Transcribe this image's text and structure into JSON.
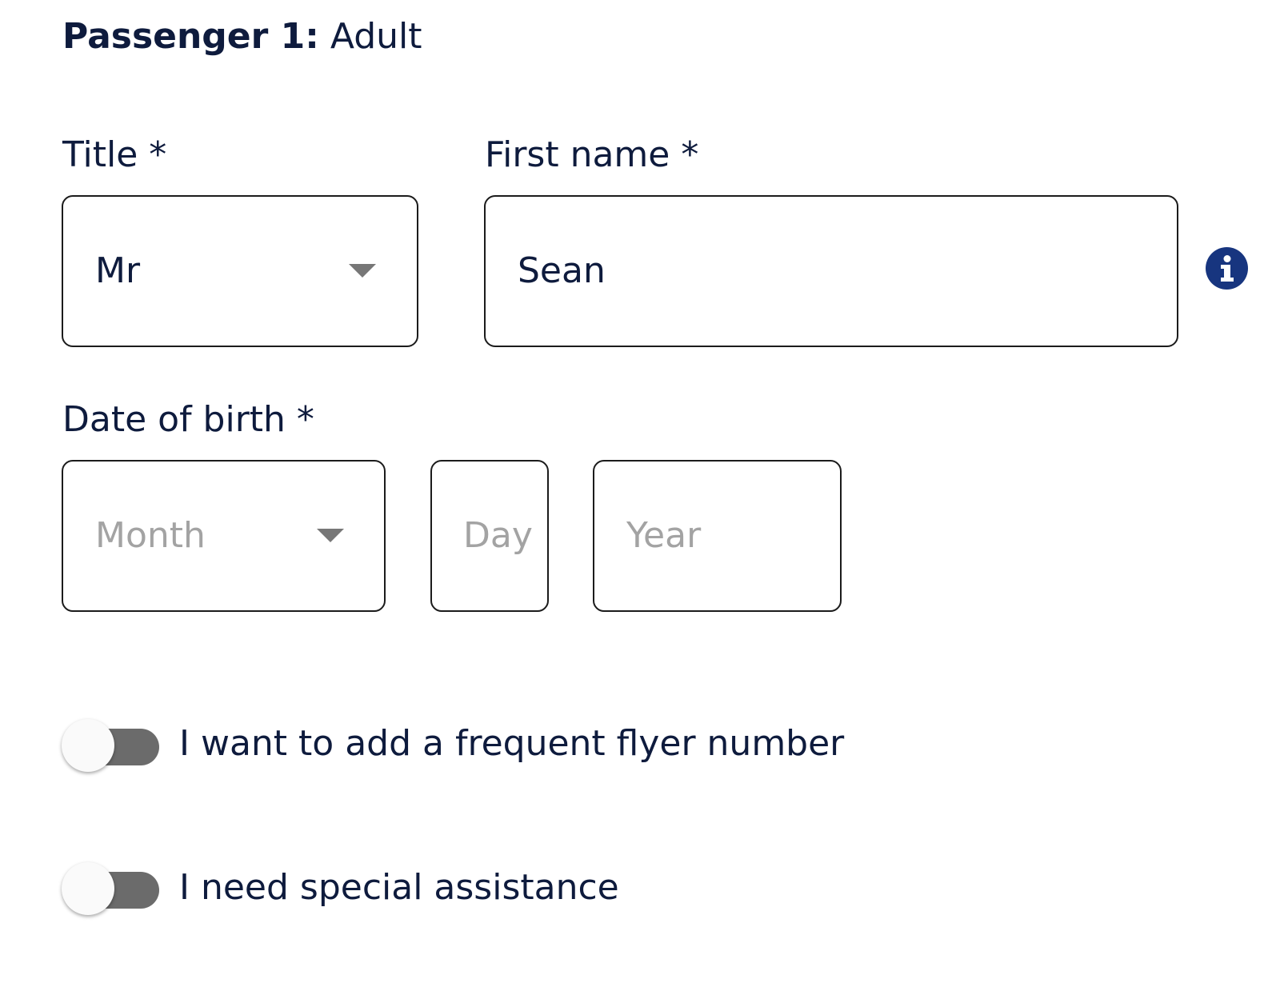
{
  "passenger": {
    "heading_bold": "Passenger 1:",
    "heading_type": "Adult"
  },
  "fields": {
    "title": {
      "label": "Title *",
      "value": "Mr"
    },
    "first_name": {
      "label": "First name *",
      "value": "Sean"
    },
    "dob": {
      "label": "Date of birth *",
      "month_placeholder": "Month",
      "day_placeholder": "Day",
      "year_placeholder": "Year"
    }
  },
  "toggles": {
    "frequent_flyer": {
      "label": "I want to add a frequent flyer number",
      "on": false
    },
    "special_assistance": {
      "label": "I need special assistance",
      "on": false
    }
  },
  "icons": {
    "info": "info-icon",
    "dropdown": "chevron-down-icon"
  },
  "colors": {
    "text": "#0e1b3d",
    "accent": "#17357f",
    "toggle_track_off": "#6b6b6b",
    "placeholder": "#a3a3a3"
  }
}
